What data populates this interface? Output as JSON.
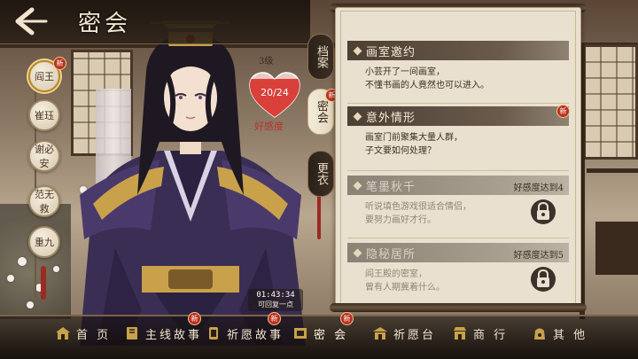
{
  "header": {
    "title": "密会"
  },
  "characters": [
    {
      "name": "阎王",
      "active": true,
      "new_badge": "新"
    },
    {
      "name": "崔珏",
      "active": false
    },
    {
      "name": "谢必安",
      "active": false
    },
    {
      "name": "范无救",
      "active": false
    },
    {
      "name": "重九",
      "active": false
    }
  ],
  "affection": {
    "level": "3级",
    "value": "20/24",
    "label": "好感度",
    "fraction": 0.833
  },
  "timer": {
    "time": "01:43:34",
    "note": "可回复一点"
  },
  "side_tabs": [
    {
      "label": "档案",
      "active": false
    },
    {
      "label": "密会",
      "active": true,
      "new_badge": "新"
    },
    {
      "label": "更衣",
      "active": false
    }
  ],
  "cards": [
    {
      "title": "画室邀约",
      "lines": [
        "小芸开了一间画室，",
        "不懂书画的人竟然也可以进入。"
      ],
      "locked": false
    },
    {
      "title": "意外情形",
      "lines": [
        "画室门前聚集大量人群，",
        "子文要如何处理？"
      ],
      "locked": false,
      "new_badge": "新"
    },
    {
      "title": "笔墨秋千",
      "requirement": "好感度达到4",
      "lines": [
        "听说填色游戏很适合情侣，",
        "要努力画好才行。"
      ],
      "locked": true
    },
    {
      "title": "隐秘居所",
      "requirement": "好感度达到5",
      "lines": [
        "阎王殿的密室，",
        "曾有人期冀着什么。"
      ],
      "locked": true
    }
  ],
  "bottom_nav": [
    {
      "label": "首 页",
      "icon": "home-icon"
    },
    {
      "label": "主线故事",
      "icon": "book-icon",
      "new_badge": "新"
    },
    {
      "label": "祈愿故事",
      "icon": "scroll-icon",
      "new_badge": "新"
    },
    {
      "label": "密 会",
      "icon": "meeting-icon",
      "active": true,
      "new_badge": "新"
    },
    {
      "label": "祈愿台",
      "icon": "altar-icon"
    },
    {
      "label": "商 行",
      "icon": "shop-icon"
    },
    {
      "label": "其 他",
      "icon": "bag-icon"
    }
  ],
  "colors": {
    "accent_red": "#b8311f",
    "gold": "#c9a14a",
    "panel": "#e9e0cf"
  }
}
